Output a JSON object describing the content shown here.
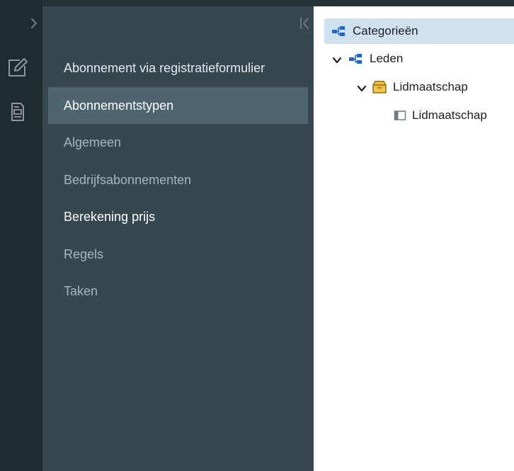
{
  "sidebar": {
    "menu": [
      {
        "label": "Abonnement via registratieformulier"
      },
      {
        "label": "Abonnementstypen"
      },
      {
        "label": "Algemeen"
      },
      {
        "label": "Bedrijfsabonnementen"
      },
      {
        "label": "Berekening prijs"
      },
      {
        "label": "Regels"
      },
      {
        "label": "Taken"
      }
    ],
    "active_index": 1
  },
  "rail": {
    "icons": [
      "chevron-right-icon",
      "edit-note-icon",
      "document-icon"
    ]
  },
  "tree": {
    "root": {
      "label": "Categorieën",
      "icon": "hierarchy-icon"
    },
    "children": [
      {
        "label": "Leden",
        "icon": "hierarchy-icon",
        "expanded": true
      },
      {
        "label": "Lidmaatschap",
        "icon": "package-icon",
        "expanded": true
      },
      {
        "label": "Lidmaatschap",
        "icon": "panel-icon"
      }
    ]
  },
  "colors": {
    "rail_bg": "#1f2b31",
    "sidebar_bg": "#37474f",
    "active_item_bg": "#4e6570",
    "tree_selected_bg": "#cfe0ee",
    "hierarchy_blue": "#1e66d0",
    "package_yellow": "#f6c445"
  }
}
